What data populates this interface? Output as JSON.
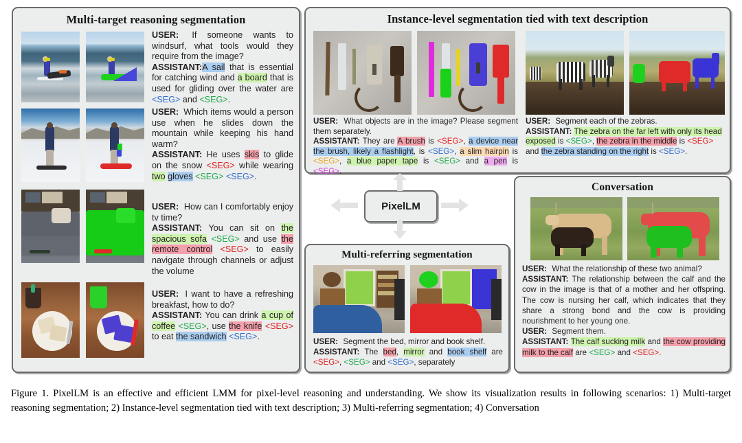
{
  "panels": {
    "multi_target": {
      "title": "Multi-target reasoning segmentation",
      "rows": [
        {
          "user_label": "USER:",
          "user_text": "If someone wants to windsurf, what tools would they require from the image?",
          "assistant_label": "ASSISTANT:",
          "assistant_parts": [
            {
              "t": "A sail",
              "hl": "blue"
            },
            {
              "t": " that is essential for catching wind and "
            },
            {
              "t": "a board",
              "hl": "green"
            },
            {
              "t": " that is used for gliding over the water are "
            },
            {
              "t": "<SEG>",
              "seg": "blue"
            },
            {
              "t": " and "
            },
            {
              "t": "<SEG>",
              "seg": "green"
            },
            {
              "t": "."
            }
          ]
        },
        {
          "user_label": "USER:",
          "user_text": "Which items would a person use when he slides down the mountain while keeping his hand warm?",
          "assistant_label": "ASSISTANT:",
          "assistant_parts": [
            {
              "t": " He uses "
            },
            {
              "t": "skis",
              "hl": "red"
            },
            {
              "t": " to glide on the snow "
            },
            {
              "t": "<SEG>",
              "seg": "red"
            },
            {
              "t": " while wearing "
            },
            {
              "t": "two",
              "hl": "green"
            },
            {
              "t": " "
            },
            {
              "t": "gloves",
              "hl": "blue"
            },
            {
              "t": " "
            },
            {
              "t": "<SEG>",
              "seg": "green"
            },
            {
              "t": " "
            },
            {
              "t": "<SEG>",
              "seg": "blue"
            },
            {
              "t": "."
            }
          ]
        },
        {
          "user_label": "USER:",
          "user_text": "How can I comfortably enjoy tv time?",
          "assistant_label": "ASSISTANT:",
          "assistant_parts": [
            {
              "t": " You can sit on "
            },
            {
              "t": "the spacious sofa",
              "hl": "green"
            },
            {
              "t": " "
            },
            {
              "t": "<SEG>",
              "seg": "green"
            },
            {
              "t": " and use "
            },
            {
              "t": "the remote control",
              "hl": "red"
            },
            {
              "t": " "
            },
            {
              "t": "<SEG>",
              "seg": "red"
            },
            {
              "t": " to easily navigate through channels or adjust the volume"
            }
          ]
        },
        {
          "user_label": "USER:",
          "user_text": "I want to have a refreshing breakfast, how to do?",
          "assistant_label": "ASSISTANT:",
          "assistant_parts": [
            {
              "t": " You can drink "
            },
            {
              "t": "a cup of coffee",
              "hl": "green"
            },
            {
              "t": " "
            },
            {
              "t": "<SEG>",
              "seg": "green"
            },
            {
              "t": ", use "
            },
            {
              "t": "the knife",
              "hl": "red"
            },
            {
              "t": " "
            },
            {
              "t": "<SEG>",
              "seg": "red"
            },
            {
              "t": " to eat "
            },
            {
              "t": "the sandwich",
              "hl": "blue"
            },
            {
              "t": " "
            },
            {
              "t": "<SEG>",
              "seg": "blue"
            },
            {
              "t": "."
            }
          ]
        }
      ]
    },
    "instance_level": {
      "title": "Instance-level  segmentation tied with text description",
      "left": {
        "user_label": "USER:",
        "user_text": "What objects are in the image? Please segment them separately.",
        "assistant_label": "ASSISTANT:",
        "assistant_parts": [
          {
            "t": " They are "
          },
          {
            "t": "A brush",
            "hl": "red"
          },
          {
            "t": " is "
          },
          {
            "t": "<SEG>",
            "seg": "red"
          },
          {
            "t": ", "
          },
          {
            "t": "a device near the brush, likely a flashlight",
            "hl": "blue"
          },
          {
            "t": ", is "
          },
          {
            "t": "<SEG>",
            "seg": "blue"
          },
          {
            "t": ", "
          },
          {
            "t": "a slim hairpin",
            "hl": "orange"
          },
          {
            "t": " is "
          },
          {
            "t": "<SEG>",
            "seg": "orange"
          },
          {
            "t": ", "
          },
          {
            "t": "a blue paper tape",
            "hl": "green"
          },
          {
            "t": " is "
          },
          {
            "t": "<SEG>",
            "seg": "green"
          },
          {
            "t": " and "
          },
          {
            "t": "a pen",
            "hl": "magenta"
          },
          {
            "t": " is "
          },
          {
            "t": "<SEG>",
            "seg": "magenta"
          },
          {
            "t": "."
          }
        ]
      },
      "right": {
        "user_label": "USER:",
        "user_text": "Segment each of the zebras.",
        "assistant_label": "ASSISTANT:",
        "assistant_parts": [
          {
            "t": " "
          },
          {
            "t": "The zebra on the far left with only its head exposed",
            "hl": "green"
          },
          {
            "t": " is "
          },
          {
            "t": "<SEG>",
            "seg": "green"
          },
          {
            "t": ", "
          },
          {
            "t": "the  zebra in the middle",
            "hl": "red"
          },
          {
            "t": " is "
          },
          {
            "t": "<SEG>",
            "seg": "red"
          },
          {
            "t": " and "
          },
          {
            "t": "the zebra standing on the right",
            "hl": "blue"
          },
          {
            "t": " is "
          },
          {
            "t": "<SEG>",
            "seg": "blue"
          },
          {
            "t": "."
          }
        ]
      }
    },
    "multi_referring": {
      "title": "Multi-referring segmentation",
      "conv": {
        "user_label": "USER:",
        "user_text": "Segment the bed, mirror and book shelf.",
        "assistant_label": "ASSISTANT:",
        "assistant_parts": [
          {
            "t": " The "
          },
          {
            "t": "bed",
            "hl": "red"
          },
          {
            "t": ", "
          },
          {
            "t": "mirror",
            "hl": "green"
          },
          {
            "t": " and "
          },
          {
            "t": "book shelf",
            "hl": "blue"
          },
          {
            "t": " are "
          },
          {
            "t": "<SEG>",
            "seg": "red"
          },
          {
            "t": ", "
          },
          {
            "t": "<SEG>",
            "seg": "green"
          },
          {
            "t": " and "
          },
          {
            "t": "<SEG>",
            "seg": "blue"
          },
          {
            "t": ", separately"
          }
        ]
      }
    },
    "conversation": {
      "title": "Conversation",
      "turns": [
        {
          "user_label": "USER:",
          "user_text": "What the relationship of these two animal?",
          "assistant_label": "ASSISTANT:",
          "assistant_parts": [
            {
              "t": " The relationship between the calf and the cow in the image is that of a mother and her offspring. The cow is nursing her calf, which indicates that they share a strong bond and the cow is providing nourishment to her young one."
            }
          ]
        },
        {
          "user_label": "USER:",
          "user_text": "Segment them.",
          "assistant_label": "ASSISTANT:",
          "assistant_parts": [
            {
              "t": " "
            },
            {
              "t": "The calf sucking milk",
              "hl": "green"
            },
            {
              "t": " and "
            },
            {
              "t": "the cow providing milk to the calf",
              "hl": "red"
            },
            {
              "t": " are "
            },
            {
              "t": "<SEG>",
              "seg": "green"
            },
            {
              "t": " and "
            },
            {
              "t": "<SEG>",
              "seg": "red"
            },
            {
              "t": "."
            }
          ]
        }
      ]
    }
  },
  "center": {
    "model_name": "PixelLM"
  },
  "caption": {
    "text": "Figure 1.   PixelLM is an effective and efficient LMM for pixel-level reasoning and understanding.  We show its visualization results in following scenarios: 1) Multi-target reasoning segmentation; 2) Instance-level segmentation tied with text description; 3) Multi-referring segmentation; 4) Conversation"
  },
  "colors": {
    "highlight_blue": "#a9cdef",
    "highlight_green": "#cdf3ae",
    "highlight_red": "#f3a0ab",
    "highlight_orange": "#fbd9b2",
    "highlight_magenta": "#edabee",
    "seg_blue": "#2f6fd0",
    "seg_green": "#1faa4b",
    "seg_red": "#e02020",
    "seg_orange": "#eda427",
    "seg_magenta": "#d83fd8",
    "panel_bg": "#eceded",
    "panel_border": "#6b6b6b",
    "arrow_fill": "#e3e3e3"
  }
}
